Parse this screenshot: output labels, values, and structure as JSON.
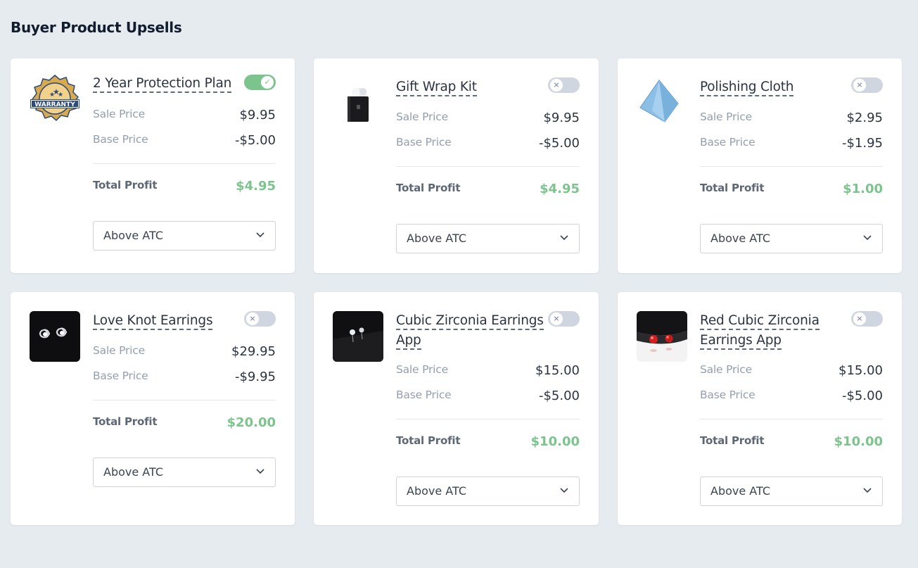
{
  "page": {
    "title": "Buyer Product Upsells"
  },
  "labels": {
    "sale_price": "Sale Price",
    "base_price": "Base Price",
    "total_profit": "Total Profit"
  },
  "colors": {
    "toggle_on": "#7cc48d",
    "toggle_off": "#cfd6df",
    "profit": "#7cc48d",
    "background": "#e6ebf0"
  },
  "products": [
    {
      "name": "2 Year Protection Plan",
      "image": "warranty-badge-icon",
      "enabled": true,
      "sale_price": "$9.95",
      "base_price": "-$5.00",
      "total_profit": "$4.95",
      "placement": "Above ATC"
    },
    {
      "name": "Gift Wrap Kit",
      "image": "gift-bag-icon",
      "enabled": false,
      "sale_price": "$9.95",
      "base_price": "-$5.00",
      "total_profit": "$4.95",
      "placement": "Above ATC"
    },
    {
      "name": "Polishing Cloth",
      "image": "cloth-icon",
      "enabled": false,
      "sale_price": "$2.95",
      "base_price": "-$1.95",
      "total_profit": "$1.00",
      "placement": "Above ATC"
    },
    {
      "name": "Love Knot Earrings",
      "image": "earrings-photo",
      "enabled": false,
      "sale_price": "$29.95",
      "base_price": "-$9.95",
      "total_profit": "$20.00",
      "placement": "Above ATC"
    },
    {
      "name": "Cubic Zirconia Earrings App",
      "image": "earrings-photo",
      "enabled": false,
      "sale_price": "$15.00",
      "base_price": "-$5.00",
      "total_profit": "$10.00",
      "placement": "Above ATC"
    },
    {
      "name": "Red Cubic Zirconia Earrings App",
      "image": "red-earrings-photo",
      "enabled": false,
      "sale_price": "$15.00",
      "base_price": "-$5.00",
      "total_profit": "$10.00",
      "placement": "Above ATC"
    }
  ]
}
